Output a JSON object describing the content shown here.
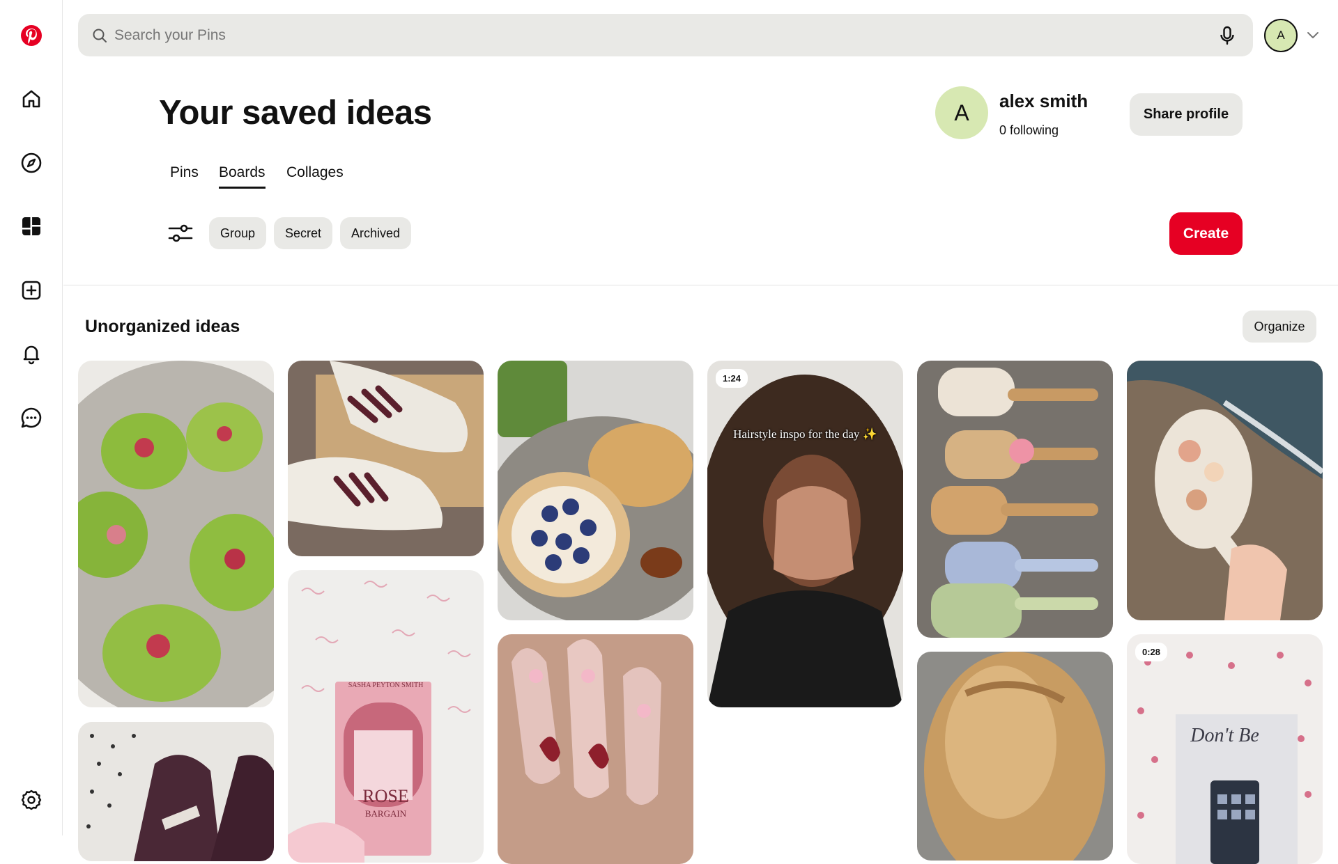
{
  "search": {
    "placeholder": "Search your Pins"
  },
  "user": {
    "initial": "A",
    "name": "alex smith",
    "following": "0 following"
  },
  "header": {
    "title": "Your saved ideas",
    "share_label": "Share profile"
  },
  "tabs": [
    {
      "label": "Pins",
      "active": false
    },
    {
      "label": "Boards",
      "active": true
    },
    {
      "label": "Collages",
      "active": false
    }
  ],
  "filters": [
    "Group",
    "Secret",
    "Archived"
  ],
  "create_label": "Create",
  "section": {
    "title": "Unorganized ideas",
    "organize_label": "Organize"
  },
  "pins": [
    {
      "name": "matcha-strawberry-treats",
      "badge": ""
    },
    {
      "name": "burgundy-sneakers",
      "badge": ""
    },
    {
      "name": "bagel-breakfast",
      "badge": ""
    },
    {
      "name": "hairstyle-video",
      "badge": "1:24",
      "overlay": "Hairstyle inspo for the day ✨"
    },
    {
      "name": "painted-hairbrushes",
      "badge": ""
    },
    {
      "name": "seashell-mirror",
      "badge": ""
    },
    {
      "name": "polka-dot-sneakers",
      "badge": ""
    },
    {
      "name": "rose-bargain-book",
      "badge": "",
      "overlay_title": "ROSE",
      "overlay_sub": "BARGAIN",
      "overlay_author": "SASHA PEYTON SMITH"
    },
    {
      "name": "floral-nails",
      "badge": ""
    },
    {
      "name": "braided-hair",
      "badge": ""
    },
    {
      "name": "dont-be-card-video",
      "badge": "0:28",
      "overlay": "Don't Be"
    }
  ],
  "colors": {
    "brand_red": "#e60023",
    "chip_bg": "#e9e9e6",
    "avatar_green": "#d7e8b2"
  },
  "icons": {
    "sidebar": [
      "pinterest-logo-icon",
      "home-icon",
      "explore-icon",
      "dashboard-icon",
      "create-icon",
      "notifications-icon",
      "messages-icon",
      "settings-icon"
    ],
    "search": "search-icon",
    "mic": "microphone-icon",
    "menu": "chevron-down-icon",
    "filter": "filter-sliders-icon"
  }
}
